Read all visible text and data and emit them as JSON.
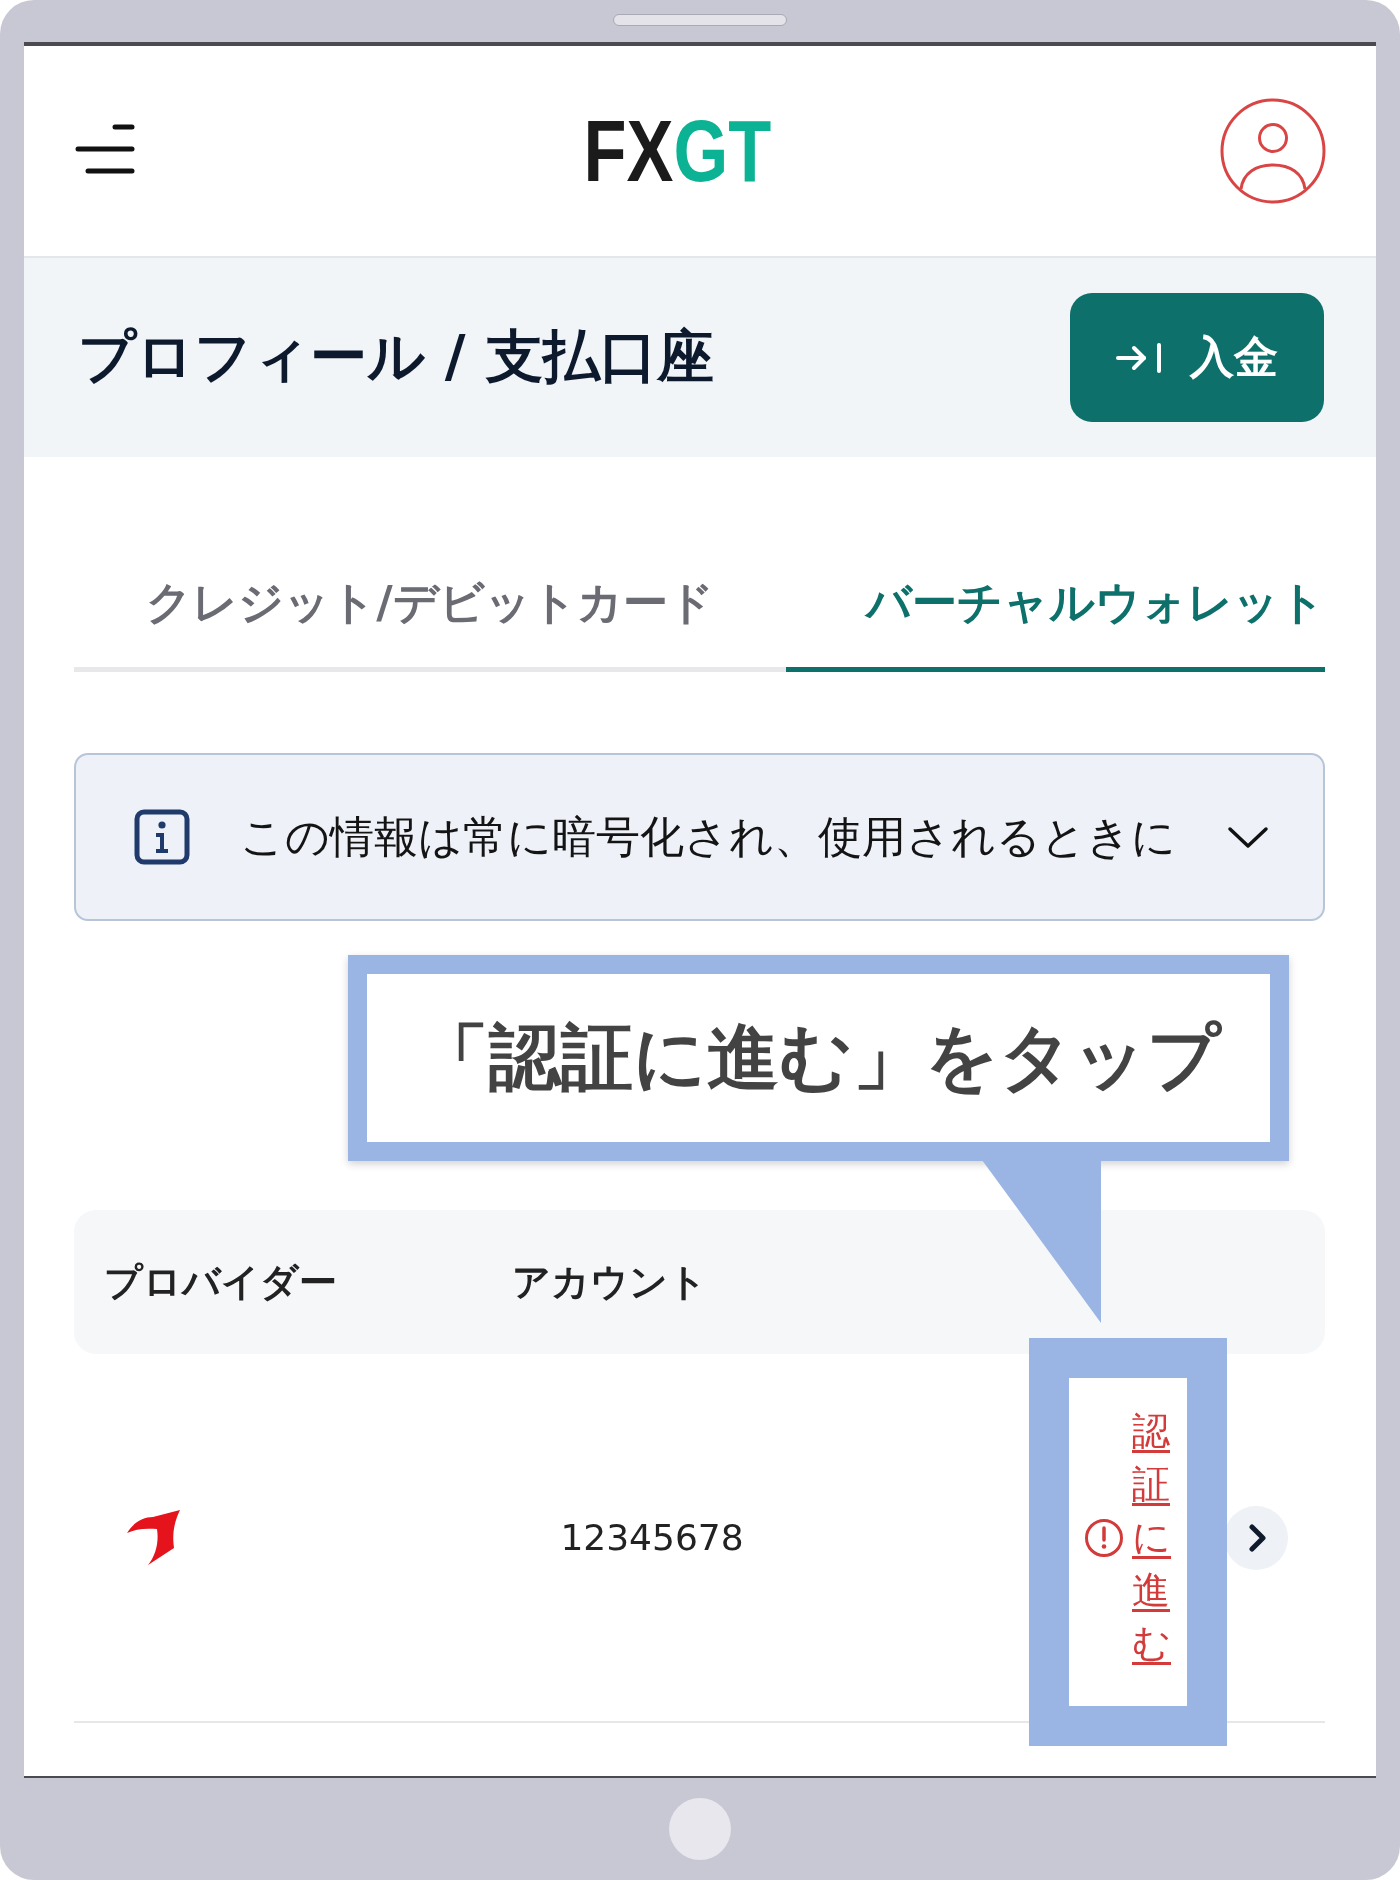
{
  "header": {
    "logo": [
      {
        "text": "FX",
        "color": "#1b1b1b"
      },
      {
        "text": "GT",
        "color": "#0bb394"
      }
    ]
  },
  "title_bar": {
    "title": "プロフィール / 支払口座",
    "button": "入金"
  },
  "tabs": [
    {
      "label": "クレジット/デビットカード",
      "selected": false
    },
    {
      "label": "バーチャルウォレット",
      "selected": true
    }
  ],
  "notice": {
    "text": "この情報は常に暗号化され、使用されるときに",
    "expanded": false
  },
  "callout": {
    "text": "「認証に進む」をタップ"
  },
  "table": {
    "columns": [
      "プロバイダー",
      "アカウント"
    ],
    "rows": [
      {
        "account": "12345678",
        "warning": true,
        "action": "認証に進む"
      }
    ]
  }
}
